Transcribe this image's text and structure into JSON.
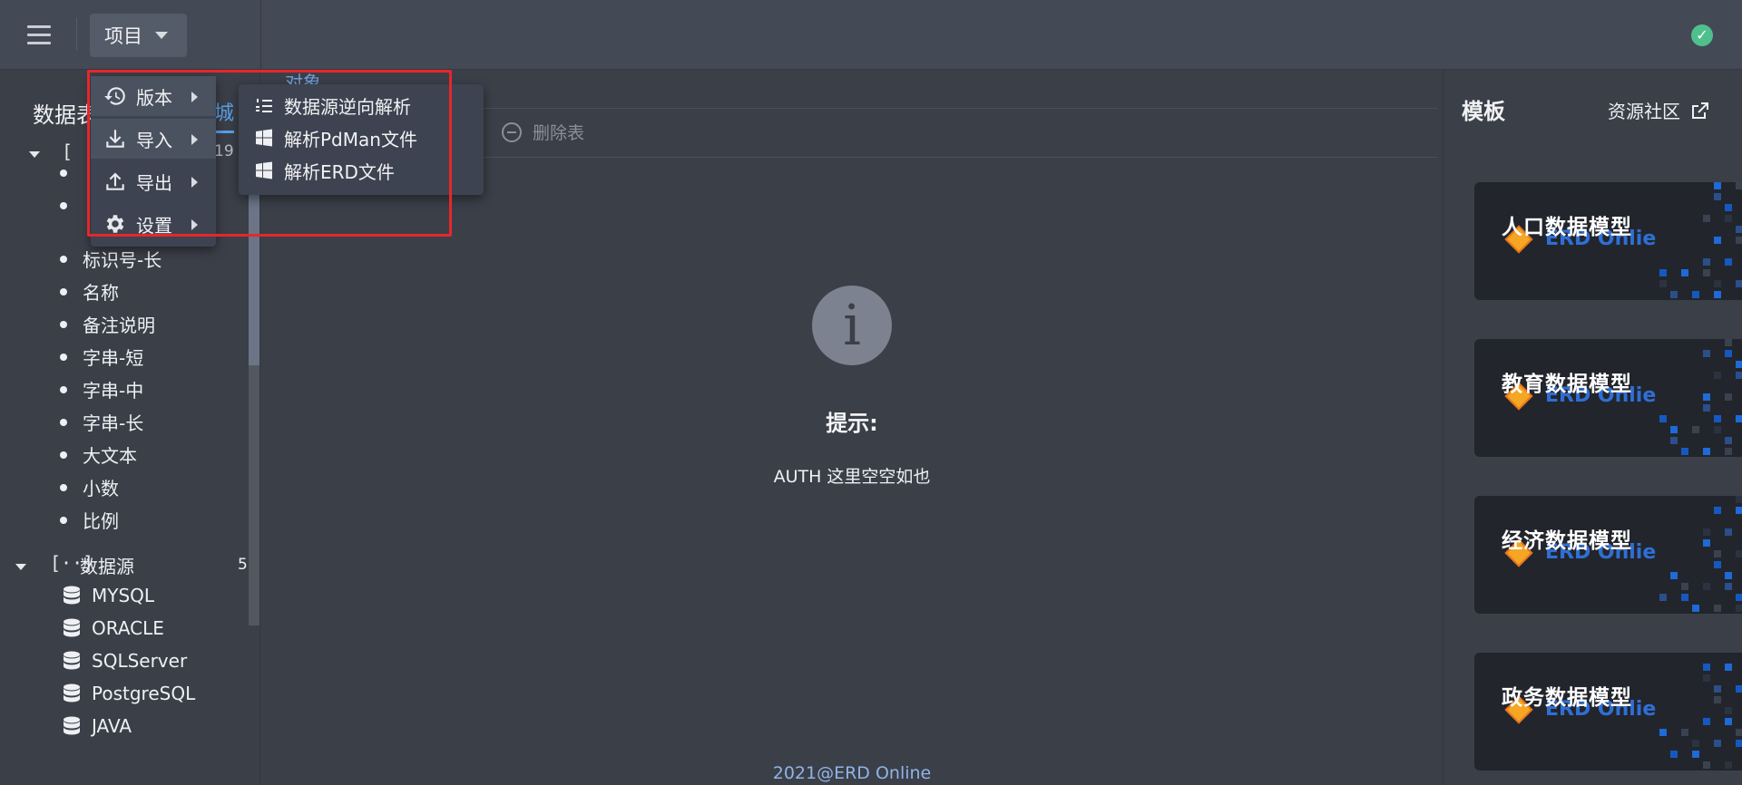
{
  "topbar": {
    "project_label": "项目"
  },
  "sidebar": {
    "title": "数据表",
    "partial_link": "城",
    "partial_count": "19",
    "fields": [
      "标识号-长",
      "名称",
      "备注说明",
      "字串-短",
      "字串-中",
      "字串-长",
      "大文本",
      "小数",
      "比例"
    ],
    "datasource": {
      "label": "数据源",
      "count": "5",
      "items": [
        "MYSQL",
        "ORACLE",
        "SQLServer",
        "PostgreSQL",
        "JAVA"
      ]
    }
  },
  "main": {
    "tab_partial": "对象",
    "delete_table": "删除表",
    "tip_title": "提示:",
    "tip_text": "AUTH 这里空空如也",
    "footer": "2021@ERD Online"
  },
  "right": {
    "title": "模板",
    "community": "资源社区",
    "brand": "ERD Onlie",
    "cards": [
      "人口数据模型",
      "教育数据模型",
      "经济数据模型",
      "政务数据模型"
    ]
  },
  "menu": {
    "items": [
      {
        "label": "版本",
        "icon": "history-icon"
      },
      {
        "label": "导入",
        "icon": "download-icon"
      },
      {
        "label": "导出",
        "icon": "upload-icon"
      },
      {
        "label": "设置",
        "icon": "gear-icon"
      }
    ],
    "submenu": [
      {
        "label": "数据源逆向解析",
        "icon": "ordered-list-icon"
      },
      {
        "label": "解析PdMan文件",
        "icon": "windows-icon"
      },
      {
        "label": "解析ERD文件",
        "icon": "windows-icon"
      }
    ]
  },
  "colors": {
    "accent_blue": "#5aa0e8",
    "highlight_red": "#e8262a",
    "status_green": "#4fc08d"
  }
}
